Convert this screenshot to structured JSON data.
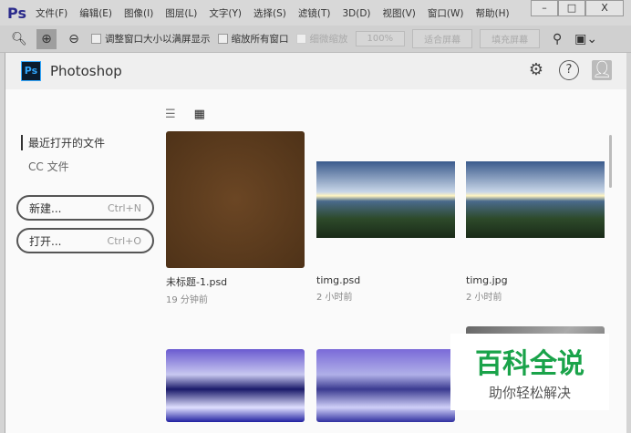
{
  "titlebar": {
    "logo": "Ps",
    "menu": [
      "文件(F)",
      "编辑(E)",
      "图像(I)",
      "图层(L)",
      "文字(Y)",
      "选择(S)",
      "滤镜(T)",
      "3D(D)",
      "视图(V)",
      "窗口(W)",
      "帮助(H)"
    ],
    "min": "–",
    "max": "□",
    "close": "X"
  },
  "toolbar": {
    "resize_windows": "调整窗口大小以满屏显示",
    "zoom_all": "缩放所有窗口",
    "scrubby": "细微缩放",
    "zoom_level": "100%",
    "fit_screen": "适合屏幕",
    "fill_screen": "填充屏幕"
  },
  "header": {
    "logo": "Ps",
    "title": "Photoshop"
  },
  "sidebar": {
    "recent": "最近打开的文件",
    "cc": "CC 文件",
    "new_label": "新建...",
    "new_shortcut": "Ctrl+N",
    "open_label": "打开...",
    "open_shortcut": "Ctrl+O"
  },
  "files": [
    {
      "name": "未标题-1.psd",
      "time": "19 分钟前"
    },
    {
      "name": "timg.psd",
      "time": "2 小时前"
    },
    {
      "name": "timg.jpg",
      "time": "2 小时前"
    }
  ],
  "watermark": {
    "line1": "百科全说",
    "line2": "助你轻松解决"
  }
}
